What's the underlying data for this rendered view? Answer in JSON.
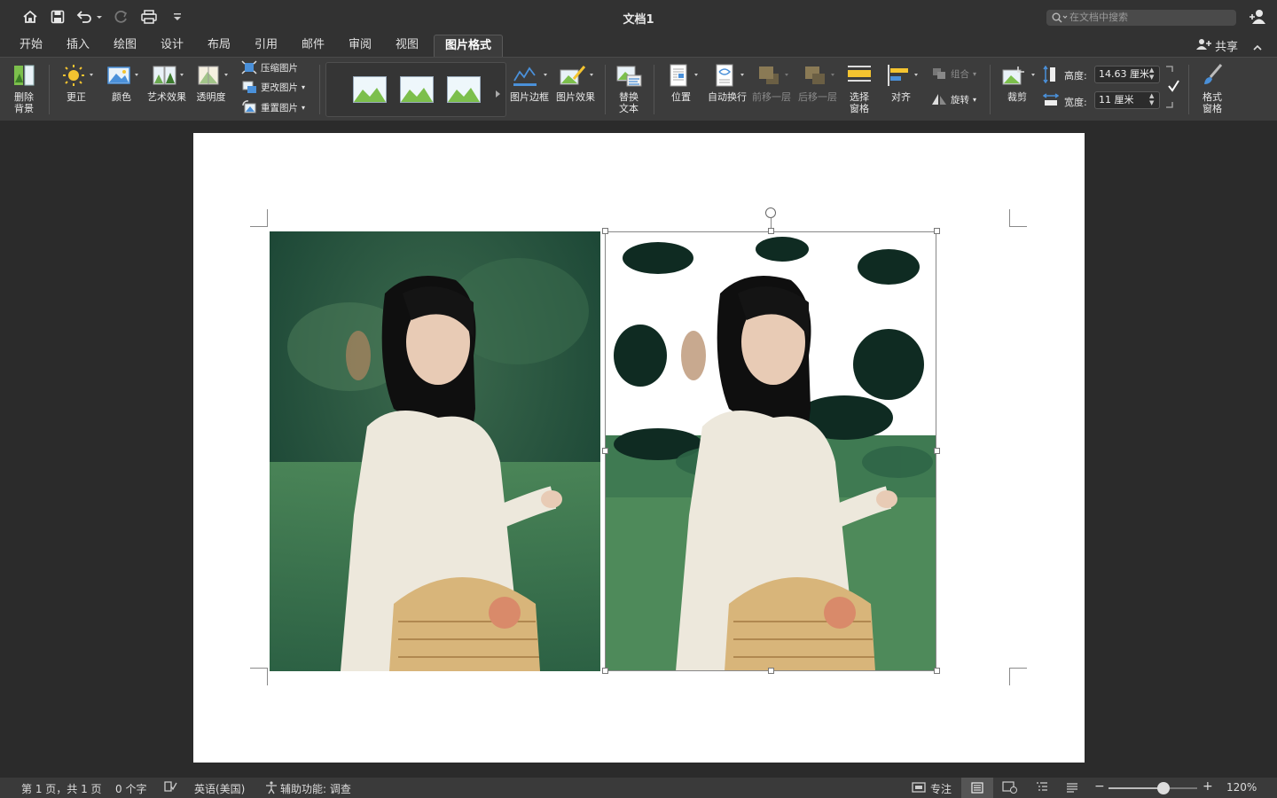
{
  "window": {
    "title": "文档1"
  },
  "search": {
    "placeholder": "在文档中搜索"
  },
  "tabs": [
    {
      "label": "开始"
    },
    {
      "label": "插入"
    },
    {
      "label": "绘图"
    },
    {
      "label": "设计"
    },
    {
      "label": "布局"
    },
    {
      "label": "引用"
    },
    {
      "label": "邮件"
    },
    {
      "label": "审阅"
    },
    {
      "label": "视图"
    },
    {
      "label": "图片格式"
    }
  ],
  "share": {
    "label": "共享"
  },
  "ribbon": {
    "remove_bg": [
      "删除",
      "背景"
    ],
    "corrections": "更正",
    "color": "颜色",
    "artistic": "艺术效果",
    "transparency": "透明度",
    "compress": "压缩图片",
    "change_picture": "更改图片",
    "reset_picture": "重置图片",
    "picture_border": "图片边框",
    "picture_effects": "图片效果",
    "alt_text": [
      "替换",
      "文本"
    ],
    "position": "位置",
    "wrap_text": "自动换行",
    "bring_forward": "前移一层",
    "send_backward": "后移一层",
    "selection_pane": [
      "选择",
      "窗格"
    ],
    "align": "对齐",
    "group": "组合",
    "rotate": "旋转",
    "crop": "裁剪",
    "height_label": "高度:",
    "height_value": "14.63 厘米",
    "width_label": "宽度:",
    "width_value": "11 厘米",
    "format_pane": [
      "格式",
      "窗格"
    ]
  },
  "status": {
    "page": "第 1 页，共 1 页",
    "words": "0 个字",
    "language": "英语(美国)",
    "accessibility": "辅助功能: 调查",
    "focus": "专注",
    "zoom": "120%",
    "zoom_level": 0.62
  },
  "colors": {
    "accent": "#ffffff",
    "ribbon_bg": "#3c3c3c",
    "canvas_bg": "#2b2b2b"
  }
}
